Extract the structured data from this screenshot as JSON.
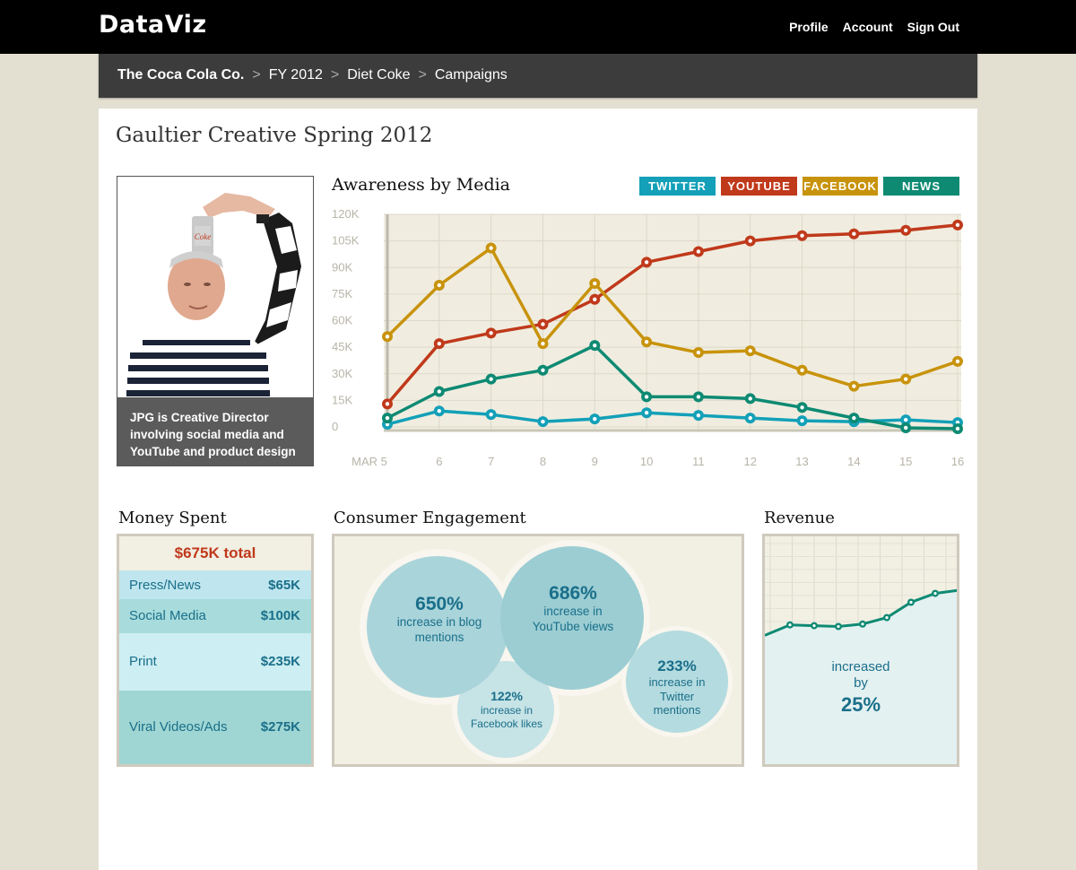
{
  "app": {
    "title": "DataViz"
  },
  "topnav": [
    "Profile",
    "Account",
    "Sign Out"
  ],
  "breadcrumb": [
    "The Coca Cola Co.",
    "FY 2012",
    "Diet Coke",
    "Campaigns"
  ],
  "page_title": "Gaultier Creative Spring 2012",
  "photo": {
    "caption": "JPG is Creative Director involving social media and YouTube and product design"
  },
  "awareness": {
    "title": "Awareness by Media",
    "legend": [
      {
        "label": "TWITTER",
        "color": "#13a0b8"
      },
      {
        "label": "YOUTUBE",
        "color": "#c0391b"
      },
      {
        "label": "FACEBOOK",
        "color": "#c8930c"
      },
      {
        "label": "NEWS",
        "color": "#0e8a73"
      }
    ]
  },
  "chart_data": {
    "type": "line",
    "title": "Awareness by Media",
    "x": [
      "MAR 5",
      "6",
      "7",
      "8",
      "9",
      "10",
      "11",
      "12",
      "13",
      "14",
      "15",
      "16"
    ],
    "yticks": [
      "120K",
      "105K",
      "90K",
      "75K",
      "60K",
      "45K",
      "30K",
      "15K",
      "0"
    ],
    "ylim": [
      0,
      120000
    ],
    "grid": true,
    "series": [
      {
        "name": "TWITTER",
        "color": "#13a0b8",
        "values": [
          1500,
          9000,
          7000,
          3000,
          4500,
          8000,
          6500,
          5000,
          3500,
          3000,
          4000,
          2500
        ]
      },
      {
        "name": "YOUTUBE",
        "color": "#c0391b",
        "values": [
          13000,
          47000,
          53000,
          58000,
          72000,
          93000,
          99000,
          105000,
          108000,
          109000,
          111000,
          114000
        ]
      },
      {
        "name": "FACEBOOK",
        "color": "#c8930c",
        "values": [
          51000,
          80000,
          101000,
          47000,
          81000,
          48000,
          42000,
          43000,
          32000,
          23000,
          27000,
          37000
        ]
      },
      {
        "name": "NEWS",
        "color": "#0e8a73",
        "values": [
          5000,
          20000,
          27000,
          32000,
          46000,
          17000,
          17000,
          16000,
          11000,
          5000,
          -500,
          -1000
        ]
      }
    ]
  },
  "money": {
    "title": "Money Spent",
    "total": "$675K total",
    "rows": [
      {
        "label": "Press/News",
        "value": "$65K",
        "color": "#bfe6ef"
      },
      {
        "label": "Social Media",
        "value": "$100K",
        "color": "#a8dcdc"
      },
      {
        "label": "Print",
        "value": "$235K",
        "color": "#cdeef3"
      },
      {
        "label": "Viral Videos/Ads",
        "value": "$275K",
        "color": "#9fd6d3"
      }
    ]
  },
  "engagement": {
    "title": "Consumer Engagement",
    "blog": {
      "pct": "650%",
      "text": "increase in blog mentions"
    },
    "youtube": {
      "pct": "686%",
      "text": "increase in YouTube views"
    },
    "facebook": {
      "pct": "122%",
      "text": "increase in Facebook likes"
    },
    "twitter": {
      "pct": "233%",
      "text": "increase in Twitter mentions"
    }
  },
  "revenue": {
    "title": "Revenue",
    "line1": "increased",
    "line2": "by",
    "pct": "25%",
    "trend": [
      0.44,
      0.57,
      0.56,
      0.55,
      0.58,
      0.66,
      0.85,
      0.96,
      1.0
    ]
  }
}
